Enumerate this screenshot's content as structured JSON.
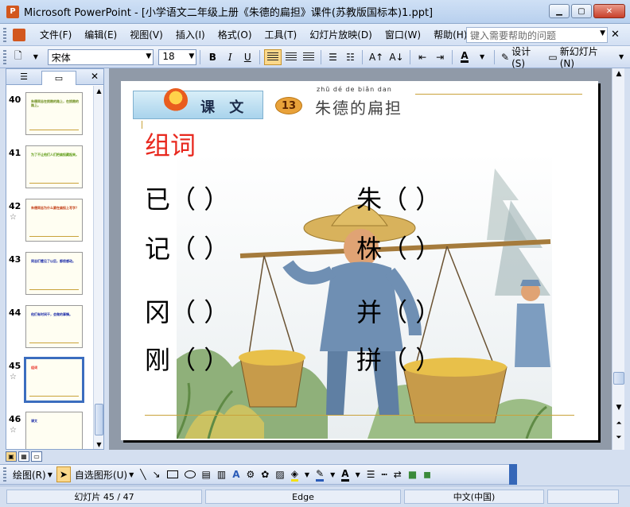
{
  "window": {
    "title": "Microsoft PowerPoint - [小学语文二年级上册《朱德的扁担》课件(苏教版国标本)1.ppt]",
    "app_icon_text": "P"
  },
  "menu": {
    "items": [
      "文件(F)",
      "编辑(E)",
      "视图(V)",
      "插入(I)",
      "格式(O)",
      "工具(T)",
      "幻灯片放映(D)",
      "窗口(W)",
      "帮助(H)"
    ],
    "help_placeholder": "键入需要帮助的问题"
  },
  "toolbar": {
    "font": "宋体",
    "size": "18",
    "bold": "B",
    "italic": "I",
    "underline": "U",
    "font_color_glyph": "A",
    "design_label": "设计(S)",
    "new_slide_label": "新幻灯片(N)"
  },
  "outline_pane": {
    "slides": [
      {
        "number": "40",
        "text": "朱德同志在挑粮的路上，在挑粮的路上。",
        "color": "#6a8c1a",
        "starred": false,
        "selected": false
      },
      {
        "number": "41",
        "text": "为了不让他们人们把扁担藏起来。",
        "color": "#5a9a10",
        "starred": false,
        "selected": false
      },
      {
        "number": "42",
        "text": "朱德同志为什么要在扁担上写字？",
        "color": "#c23a10",
        "starred": true,
        "selected": false
      },
      {
        "number": "43",
        "text": "同志们看见了以后，都很感动。",
        "color": "#1a2aa8",
        "starred": false,
        "selected": false
      },
      {
        "number": "44",
        "text": "他们有时间干，会做的事情。",
        "color": "#1a2aa8",
        "starred": false,
        "selected": false
      },
      {
        "number": "45",
        "text": "组词",
        "color": "#e8281e",
        "starred": true,
        "selected": true
      },
      {
        "number": "46",
        "text": "课文",
        "color": "#1a2aa8",
        "starred": true,
        "selected": false
      }
    ]
  },
  "slide": {
    "badge": "课 文",
    "lesson_number": "13",
    "pinyin": "zhū   dé   de  biǎn  dan",
    "lesson_title": "朱德的扁担",
    "section_title": "组词",
    "words": [
      {
        "char": "已",
        "blank": "（        ）"
      },
      {
        "char": "朱",
        "blank": "（        ）"
      },
      {
        "char": "记",
        "blank": "（        ）"
      },
      {
        "char": "株",
        "blank": "（        ）"
      },
      {
        "char": "冈",
        "blank": "（        ）"
      },
      {
        "char": "并",
        "blank": "（        ）"
      },
      {
        "char": "刚",
        "blank": "（        ）"
      },
      {
        "char": "拼",
        "blank": "（        ）"
      }
    ]
  },
  "drawing_toolbar": {
    "draw_label": "绘图(R)",
    "autoshapes_label": "自选图形(U)"
  },
  "status": {
    "slide_counter": "幻灯片 45 / 47",
    "design": "Edge",
    "language": "中文(中国)"
  }
}
